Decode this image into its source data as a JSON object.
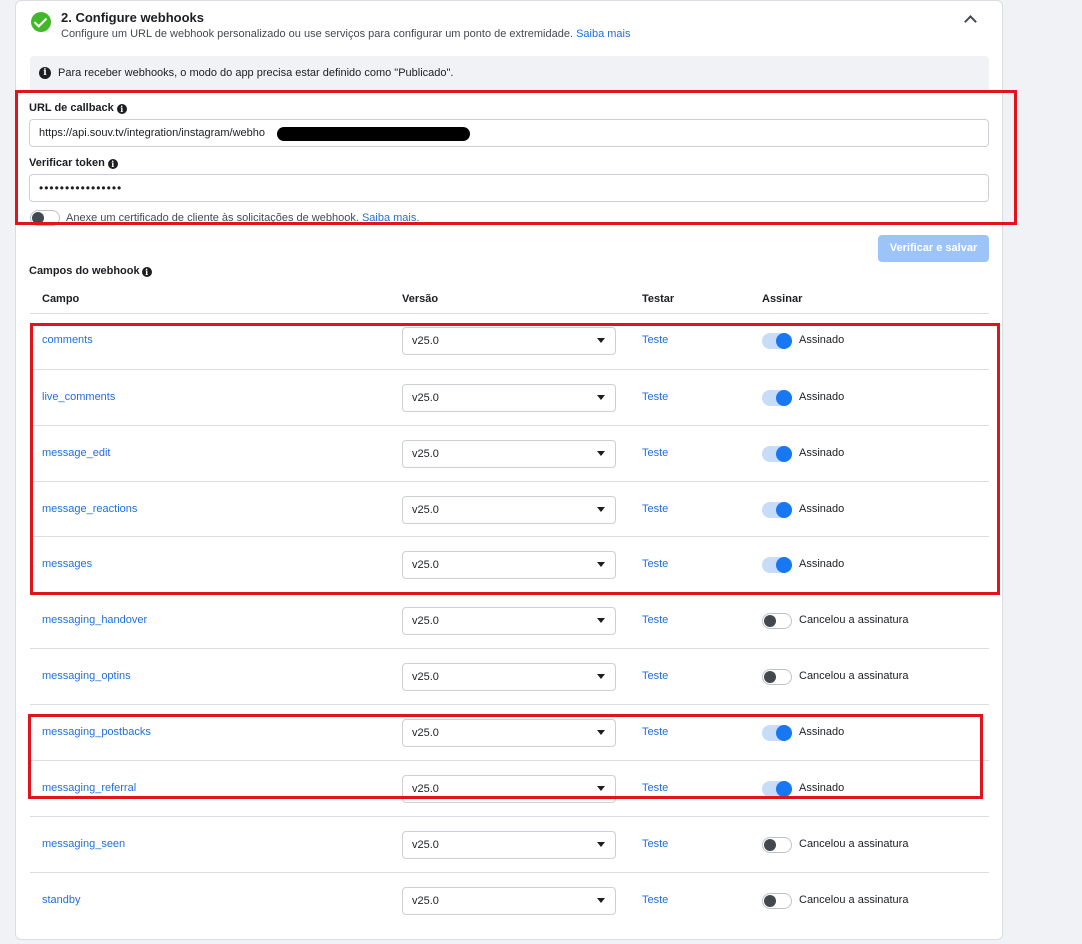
{
  "section": {
    "title": "2. Configure webhooks",
    "description": "Configure um URL de webhook personalizado ou use serviços para configurar um ponto de extremidade.",
    "learn_more": "Saiba mais",
    "notice": "Para receber webhooks, o modo do app precisa estar definido como \"Publicado\"."
  },
  "callback": {
    "label": "URL de callback",
    "value": "https://api.souv.tv/integration/instagram/webho"
  },
  "token": {
    "label": "Verificar token",
    "value": "••••••••••••••••"
  },
  "certificate": {
    "text": "Anexe um certificado de cliente às solicitações de webhook.",
    "link": "Saiba mais.",
    "enabled": false
  },
  "verify_button": "Verificar e salvar",
  "fields": {
    "title": "Campos do webhook",
    "headers": {
      "field": "Campo",
      "version": "Versão",
      "test": "Testar",
      "subscribe": "Assinar"
    },
    "rows": [
      {
        "name": "comments",
        "version": "v25.0",
        "test": "Teste",
        "subscribed": true,
        "status": "Assinado"
      },
      {
        "name": "live_comments",
        "version": "v25.0",
        "test": "Teste",
        "subscribed": true,
        "status": "Assinado"
      },
      {
        "name": "message_edit",
        "version": "v25.0",
        "test": "Teste",
        "subscribed": true,
        "status": "Assinado"
      },
      {
        "name": "message_reactions",
        "version": "v25.0",
        "test": "Teste",
        "subscribed": true,
        "status": "Assinado"
      },
      {
        "name": "messages",
        "version": "v25.0",
        "test": "Teste",
        "subscribed": true,
        "status": "Assinado"
      },
      {
        "name": "messaging_handover",
        "version": "v25.0",
        "test": "Teste",
        "subscribed": false,
        "status": "Cancelou a assinatura"
      },
      {
        "name": "messaging_optins",
        "version": "v25.0",
        "test": "Teste",
        "subscribed": false,
        "status": "Cancelou a assinatura"
      },
      {
        "name": "messaging_postbacks",
        "version": "v25.0",
        "test": "Teste",
        "subscribed": true,
        "status": "Assinado"
      },
      {
        "name": "messaging_referral",
        "version": "v25.0",
        "test": "Teste",
        "subscribed": true,
        "status": "Assinado"
      },
      {
        "name": "messaging_seen",
        "version": "v25.0",
        "test": "Teste",
        "subscribed": false,
        "status": "Cancelou a assinatura"
      },
      {
        "name": "standby",
        "version": "v25.0",
        "test": "Teste",
        "subscribed": false,
        "status": "Cancelou a assinatura"
      }
    ]
  },
  "colors": {
    "link": "#216fdb",
    "toggle_on": "#1877f2",
    "success": "#42b72a",
    "highlight": "#e0141b",
    "button_disabled": "#9cc4f8"
  }
}
